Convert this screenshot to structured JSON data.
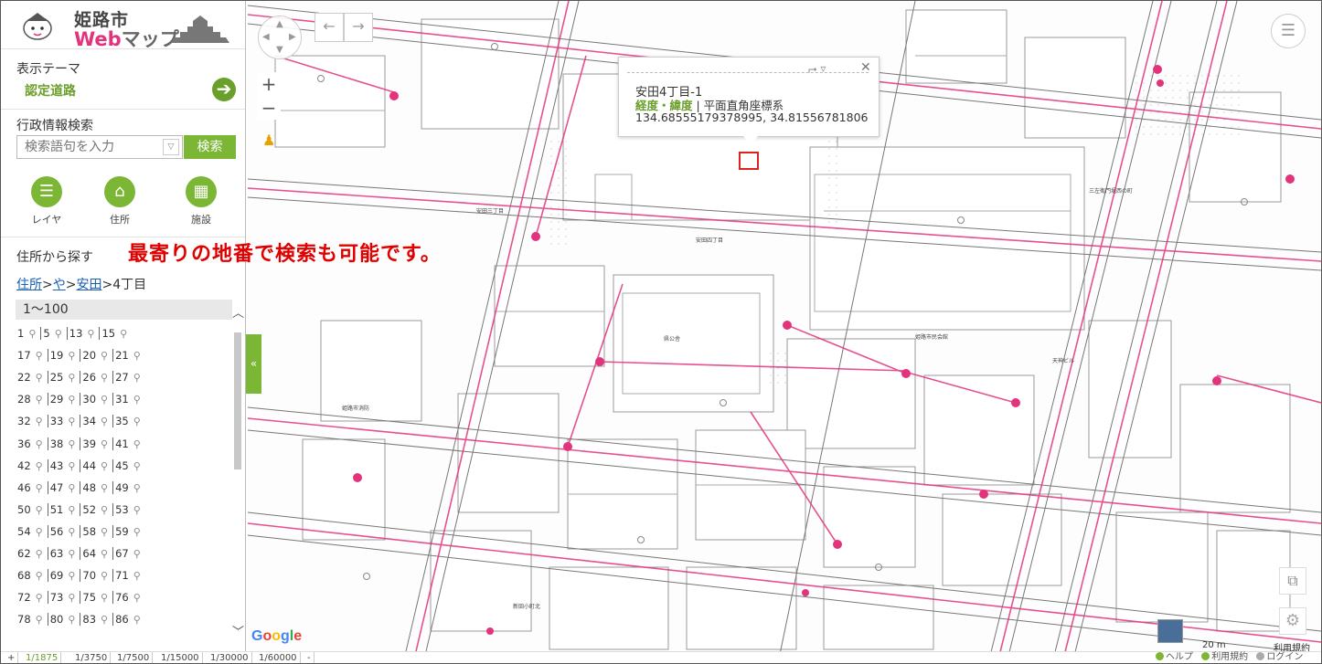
{
  "app": {
    "city": "姫路市",
    "web": "Web",
    "map": "マップ"
  },
  "sidebar": {
    "theme_label": "表示テーマ",
    "theme_value": "認定道路",
    "admin_search_label": "行政情報検索",
    "search_placeholder": "検索語句を入力",
    "search_button": "検索",
    "nav": [
      {
        "label": "レイヤ",
        "icon": "list-icon"
      },
      {
        "label": "住所",
        "icon": "home-icon"
      },
      {
        "label": "施設",
        "icon": "building-icon"
      }
    ],
    "address_search_label": "住所から探す",
    "breadcrumb": {
      "root": "住所",
      "level1": "や",
      "level2": "安田",
      "current": "4丁目"
    },
    "range": "1～100",
    "address_rows": [
      [
        "1",
        "5",
        "13",
        "15",
        ""
      ],
      [
        "17",
        "19",
        "20",
        "21",
        ""
      ],
      [
        "22",
        "25",
        "26",
        "27",
        ""
      ],
      [
        "28",
        "29",
        "30",
        "31",
        ""
      ],
      [
        "32",
        "33",
        "34",
        "35",
        ""
      ],
      [
        "36",
        "38",
        "39",
        "41",
        ""
      ],
      [
        "42",
        "43",
        "44",
        "45",
        ""
      ],
      [
        "46",
        "47",
        "48",
        "49",
        ""
      ],
      [
        "50",
        "51",
        "52",
        "53",
        ""
      ],
      [
        "54",
        "56",
        "58",
        "59",
        ""
      ],
      [
        "62",
        "63",
        "64",
        "67",
        ""
      ],
      [
        "68",
        "69",
        "70",
        "71",
        ""
      ],
      [
        "72",
        "73",
        "75",
        "76",
        ""
      ],
      [
        "78",
        "80",
        "83",
        "86",
        ""
      ]
    ]
  },
  "annotation": "最寄りの地番で検索も可能です。",
  "popup": {
    "title": "安田4丁目-1",
    "coord_system_highlight": "経度・緯度",
    "coord_system_rest": " | 平面直角座標系",
    "coords": "134.68555179378995, 34.81556781806"
  },
  "scales": [
    "+",
    "1/1875",
    "1/3750",
    "1/7500",
    "1/15000",
    "1/30000",
    "1/60000",
    "-"
  ],
  "selected_scale": "1/1875",
  "footer": {
    "help": "ヘルプ",
    "terms": "利用規約",
    "login": "ログイン",
    "scale_text": "20 m",
    "terms_top": "利用規約"
  },
  "colors": {
    "accent_green": "#7bb634",
    "road_pink": "#e2337c",
    "annotation_red": "#e00000"
  }
}
